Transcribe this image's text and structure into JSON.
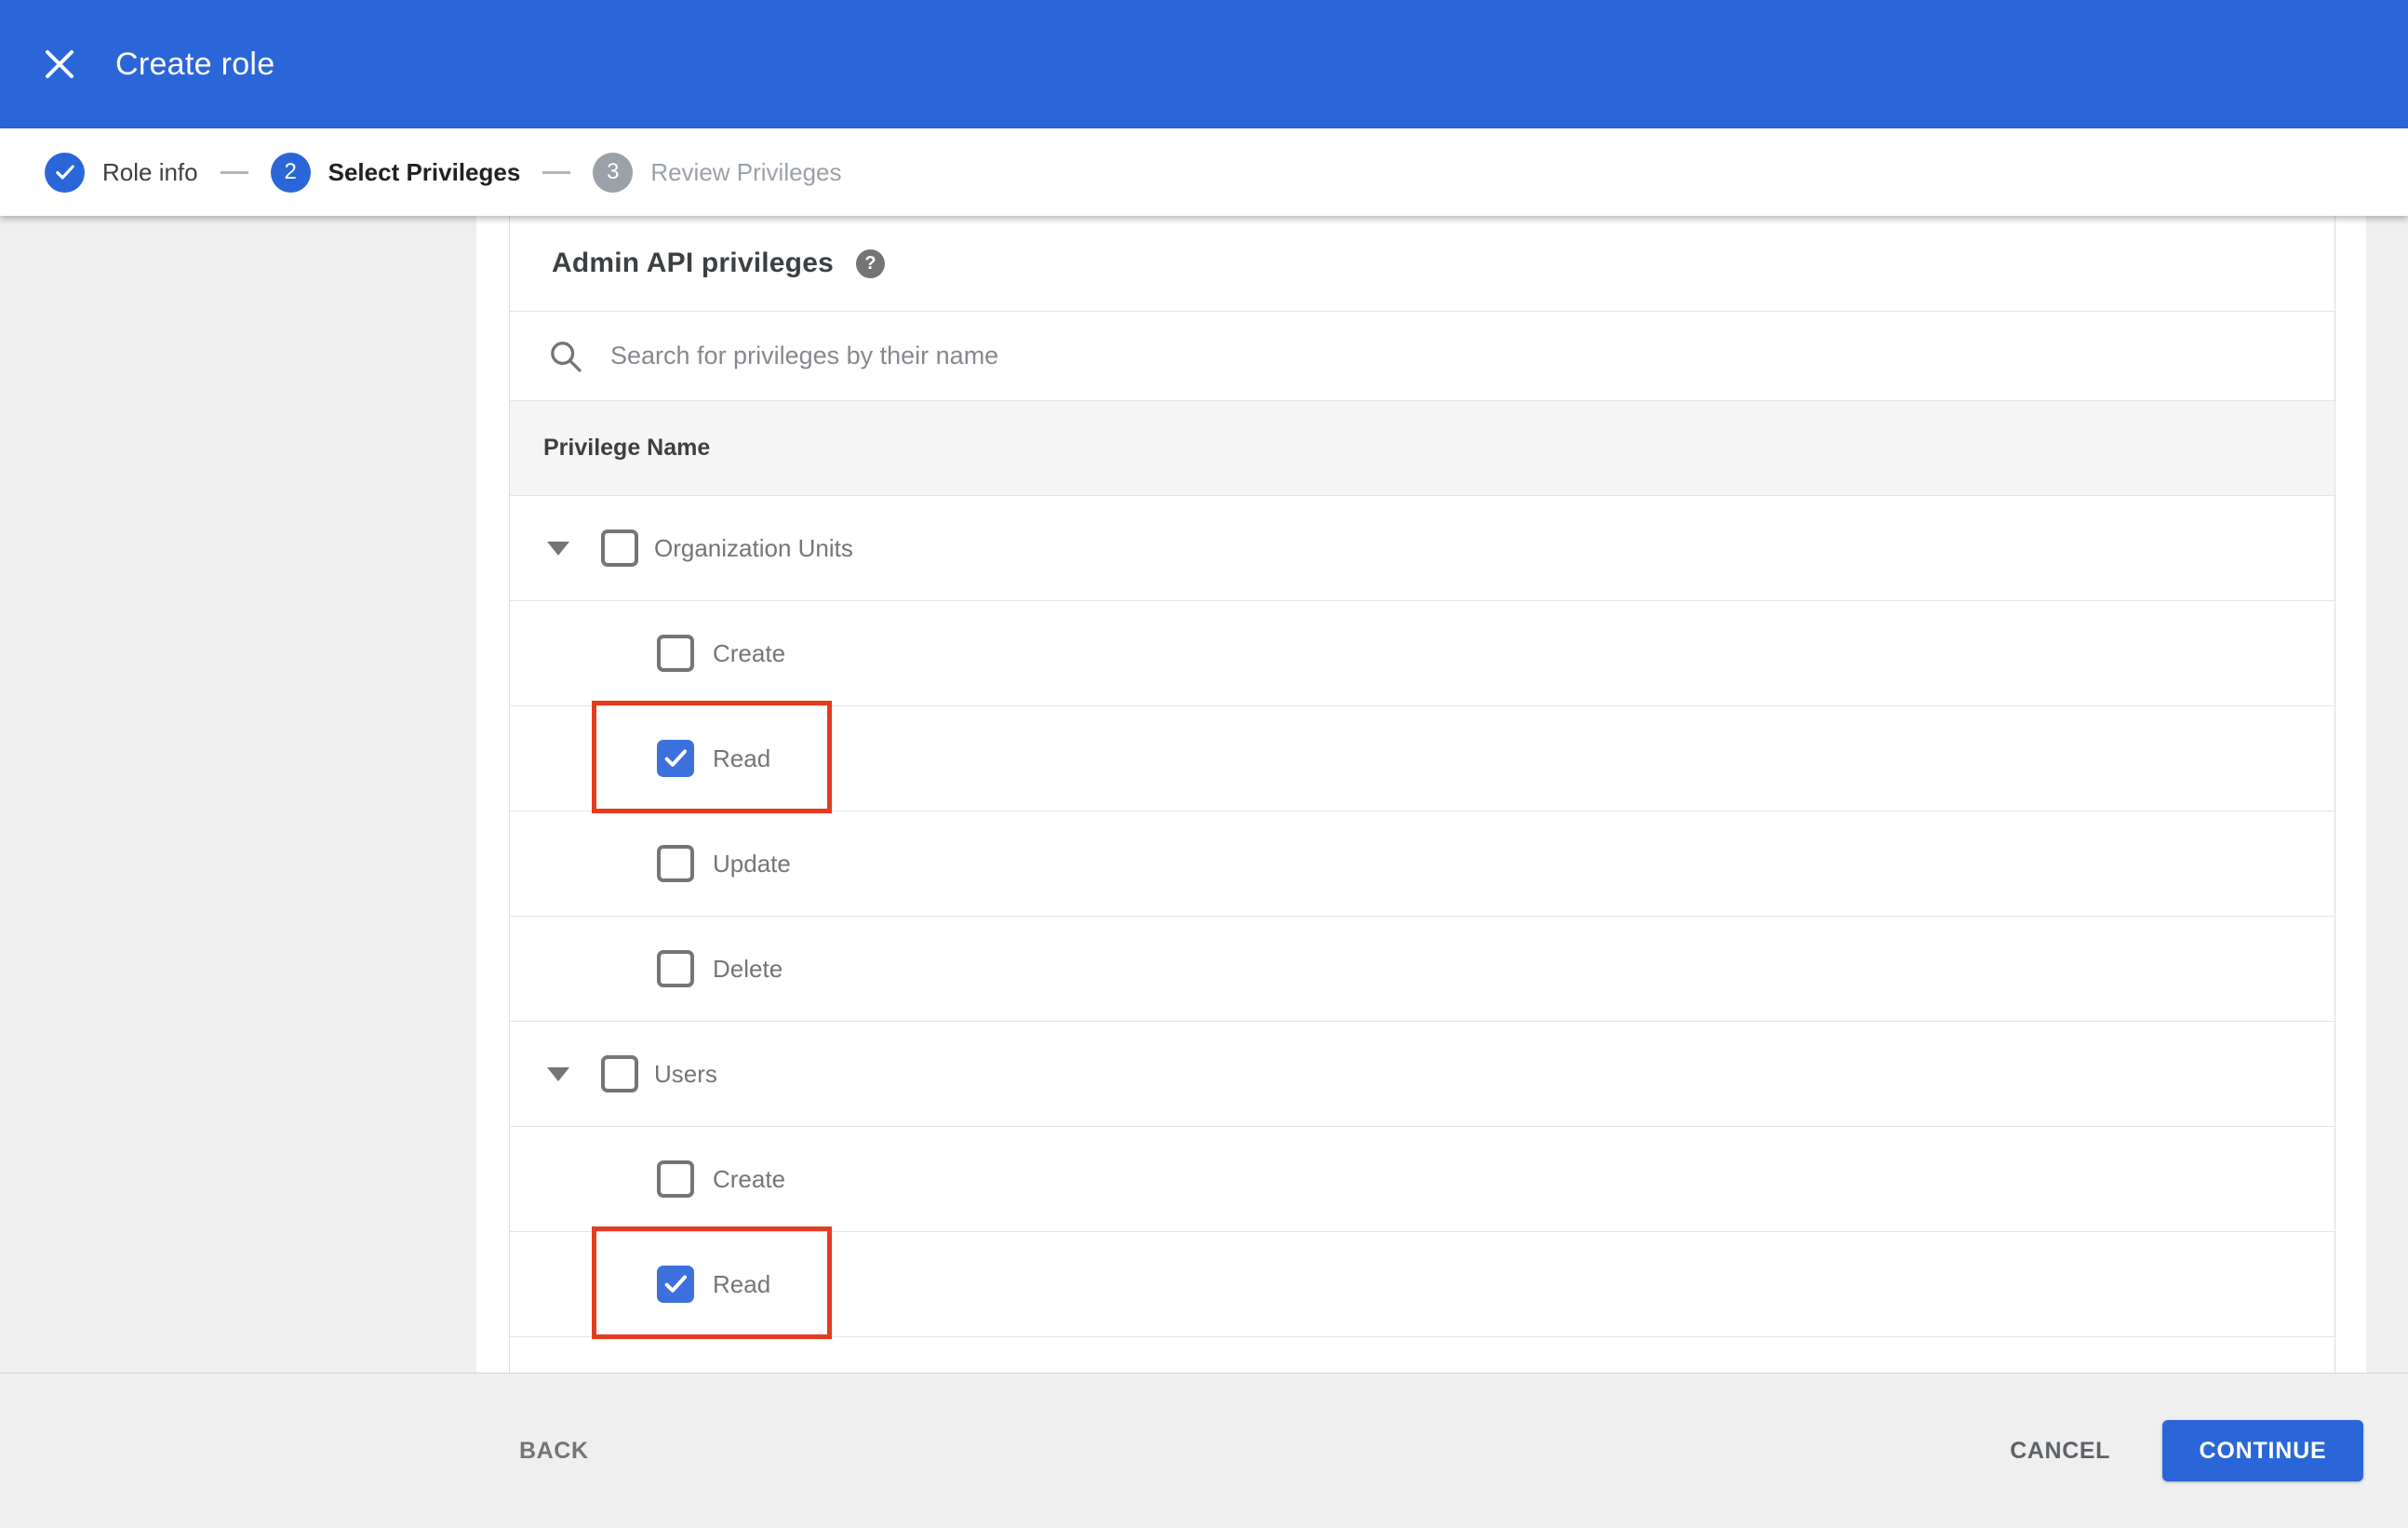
{
  "header": {
    "title": "Create role",
    "close_icon": "x-icon"
  },
  "stepper": {
    "steps": [
      {
        "num": "1",
        "label": "Role info",
        "state": "completed",
        "icon": "check-icon"
      },
      {
        "num": "2",
        "label": "Select Privileges",
        "state": "active"
      },
      {
        "num": "3",
        "label": "Review Privileges",
        "state": "upcoming"
      }
    ]
  },
  "content": {
    "section_title": "Admin API privileges",
    "help_icon": "?",
    "search_placeholder": "Search for privileges by their name",
    "table": {
      "header": "Privilege Name",
      "rows": [
        {
          "kind": "group",
          "label": "Organization Units",
          "checked": false,
          "expanded": true
        },
        {
          "kind": "child",
          "group": "Organization Units",
          "label": "Create",
          "checked": false,
          "highlighted": false
        },
        {
          "kind": "child",
          "group": "Organization Units",
          "label": "Read",
          "checked": true,
          "highlighted": true
        },
        {
          "kind": "child",
          "group": "Organization Units",
          "label": "Update",
          "checked": false,
          "highlighted": false
        },
        {
          "kind": "child",
          "group": "Organization Units",
          "label": "Delete",
          "checked": false,
          "highlighted": false
        },
        {
          "kind": "group",
          "label": "Users",
          "checked": false,
          "expanded": true
        },
        {
          "kind": "child",
          "group": "Users",
          "label": "Create",
          "checked": false,
          "highlighted": false
        },
        {
          "kind": "child",
          "group": "Users",
          "label": "Read",
          "checked": true,
          "highlighted": true
        }
      ]
    }
  },
  "footer": {
    "back": "BACK",
    "cancel": "CANCEL",
    "continue": "CONTINUE"
  },
  "colors": {
    "app_bar_blue": "#2b66d9",
    "checkbox_blue": "#3c70dd",
    "continue_blue": "#2b66d9",
    "step_inactive_gray": "#9aa1a8",
    "highlight_red": "#e63b1e",
    "page_background": "#efefef",
    "table_header_background": "#f5f5f5"
  }
}
